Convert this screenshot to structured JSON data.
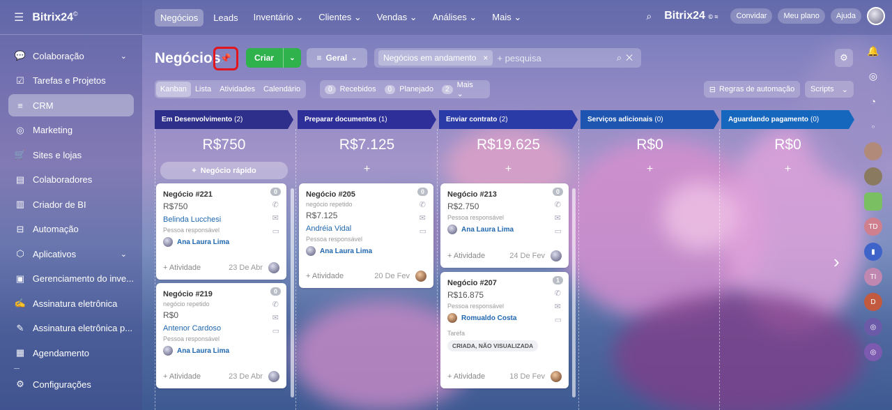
{
  "brand": {
    "name": "Bitrix24",
    "mark": "©"
  },
  "sidebar": {
    "items": [
      {
        "label": "Colaboração",
        "icon": "chat-icon",
        "glyph": "💬",
        "chevron": true
      },
      {
        "label": "Tarefas e Projetos",
        "icon": "checkbox-icon",
        "glyph": "☑"
      },
      {
        "label": "CRM",
        "icon": "filter-icon",
        "glyph": "≡",
        "active": true
      },
      {
        "label": "Marketing",
        "icon": "target-icon",
        "glyph": "◎"
      },
      {
        "label": "Sites e lojas",
        "icon": "cart-icon",
        "glyph": "🛒"
      },
      {
        "label": "Colaboradores",
        "icon": "id-card-icon",
        "glyph": "▤"
      },
      {
        "label": "Criador de BI",
        "icon": "bar-chart-icon",
        "glyph": "▥"
      },
      {
        "label": "Automação",
        "icon": "robot-icon",
        "glyph": "⊟"
      },
      {
        "label": "Aplicativos",
        "icon": "cube-icon",
        "glyph": "⬡",
        "chevron": true
      },
      {
        "label": "Gerenciamento do inve...",
        "icon": "inventory-icon",
        "glyph": "▣"
      },
      {
        "label": "Assinatura eletrônica",
        "icon": "pen-icon",
        "glyph": "✍"
      },
      {
        "label": "Assinatura eletrônica p...",
        "icon": "document-pen-icon",
        "glyph": "✎"
      },
      {
        "label": "Agendamento",
        "icon": "calendar-icon",
        "glyph": "▦"
      }
    ],
    "settings_label": "Configurações"
  },
  "topnav": {
    "tabs": [
      {
        "label": "Negócios",
        "active": true
      },
      {
        "label": "Leads"
      },
      {
        "label": "Inventário ⌄"
      },
      {
        "label": "Clientes ⌄"
      },
      {
        "label": "Vendas ⌄"
      },
      {
        "label": "Análises ⌄"
      },
      {
        "label": "Mais ⌄"
      }
    ],
    "brand_right": "Bitrix24",
    "invite": "Convidar",
    "plan": "Meu plano",
    "help": "Ajuda"
  },
  "toolbar": {
    "title": "Negócios",
    "create": "Criar",
    "geral": "Geral",
    "filter_chip": "Negócios em andamento",
    "search_placeholder": "+ pesquisa"
  },
  "views": [
    "Kanban",
    "Lista",
    "Atividades",
    "Calendário"
  ],
  "counters": [
    {
      "n": "0",
      "label": "Recebidos"
    },
    {
      "n": "0",
      "label": "Planejado"
    },
    {
      "n": "2",
      "label": "Mais ⌄"
    }
  ],
  "automation_label": "Regras de automação",
  "scripts_label": "Scripts",
  "quick_deal": "Negócio rápido",
  "columns": [
    {
      "name": "Em Desenvolvimento",
      "count": "(2)",
      "sum": "R$750",
      "color": "#2e2f8a"
    },
    {
      "name": "Preparar documentos",
      "count": "(1)",
      "sum": "R$7.125",
      "color": "#2f2f9a"
    },
    {
      "name": "Enviar contrato",
      "count": "(2)",
      "sum": "R$19.625",
      "color": "#2a3aa6"
    },
    {
      "name": "Serviços adicionais",
      "count": "(0)",
      "sum": "R$0",
      "color": "#1d55b0"
    },
    {
      "name": "Aguardando pagamento",
      "count": "(0)",
      "sum": "R$0",
      "color": "#1566bd"
    }
  ],
  "cards": [
    {
      "title": "Negócio #221",
      "badge": "0",
      "amount": "R$750",
      "client": "Belinda Lucchesi",
      "resp_label": "Pessoa responsável",
      "resp": "Ana Laura Lima",
      "activity": "+ Atividade",
      "date": "23 De Abr"
    },
    {
      "title": "Negócio #219",
      "badge": "0",
      "sub": "negócio repetido",
      "amount": "R$0",
      "client": "Antenor Cardoso",
      "resp_label": "Pessoa responsável",
      "resp": "Ana Laura Lima",
      "activity": "+ Atividade",
      "date": "23 De Abr"
    },
    {
      "title": "Negócio #205",
      "badge": "0",
      "sub": "negócio repetido",
      "amount": "R$7.125",
      "client": "Andréia Vidal",
      "resp_label": "Pessoa responsável",
      "resp": "Ana Laura Lima",
      "activity": "+ Atividade",
      "date": "20 De Fev"
    },
    {
      "title": "Negócio #213",
      "badge": "0",
      "amount": "R$2.750",
      "resp_label": "Pessoa responsável",
      "resp": "Ana Laura Lima",
      "activity": "+ Atividade",
      "date": "24 De Fev"
    },
    {
      "title": "Negócio #207",
      "badge": "1",
      "amount": "R$16.875",
      "resp_label": "Pessoa responsável",
      "resp": "Romualdo Costa",
      "task_label": "Tarefa",
      "task_status": "CRIADA, NÃO VISUALIZADA",
      "activity": "+ Atividade",
      "date": "18 De Fev"
    }
  ],
  "right_bar": [
    "TD",
    "TI",
    "D"
  ]
}
